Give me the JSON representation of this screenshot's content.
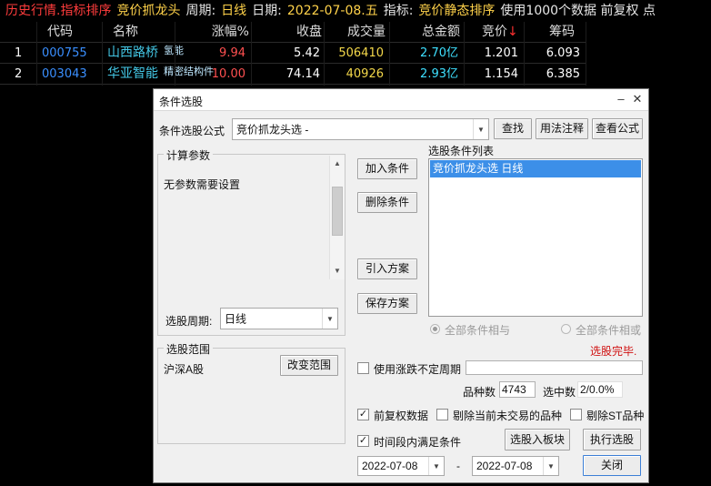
{
  "header": {
    "segments": [
      {
        "text": "历史行情.指标排序",
        "color": "red"
      },
      {
        "text": "竞价抓龙头",
        "color": "yellow"
      },
      {
        "text": "周期:",
        "color": "white"
      },
      {
        "text": "日线",
        "color": "yellow"
      },
      {
        "text": "日期:",
        "color": "white"
      },
      {
        "text": "2022-07-08.五",
        "color": "yellow"
      },
      {
        "text": "指标:",
        "color": "white"
      },
      {
        "text": "竞价静态排序",
        "color": "yellow"
      },
      {
        "text": "使用1000个数据 前复权 点",
        "color": "white"
      }
    ]
  },
  "table": {
    "columns": [
      "代码",
      "名称",
      "涨幅%",
      "收盘",
      "成交量",
      "总金额",
      "竞价",
      "筹码"
    ],
    "sort_arrow": "↓",
    "rows": [
      {
        "idx": "1",
        "code": "000755",
        "name": "山西路桥",
        "tag": "氢能",
        "chg": "9.94",
        "close": "5.42",
        "vol": "506410",
        "amount": "2.70亿",
        "bid": "1.201",
        "chip": "6.093"
      },
      {
        "idx": "2",
        "code": "003043",
        "name": "华亚智能",
        "tag": "精密结构件",
        "chg": "10.00",
        "close": "74.14",
        "vol": "40926",
        "amount": "2.93亿",
        "bid": "1.154",
        "chip": "6.385"
      }
    ]
  },
  "dialog": {
    "title": "条件选股",
    "formula_label": "条件选股公式",
    "formula_value": "竞价抓龙头选 -",
    "btn_find": "查找",
    "btn_usage": "用法注释",
    "btn_view": "查看公式",
    "params_group": "计算参数",
    "params_text": "无参数需要设置",
    "period_label": "选股周期:",
    "period_value": "日线",
    "btn_add": "加入条件",
    "btn_delete": "删除条件",
    "btn_import": "引入方案",
    "btn_save": "保存方案",
    "list_label": "选股条件列表",
    "list_items": [
      "竞价抓龙头选  日线"
    ],
    "radio_and": "全部条件相与",
    "radio_or": "全部条件相或",
    "status": "选股完毕.",
    "scope_group": "选股范围",
    "scope_value": "沪深A股",
    "btn_change_scope": "改变范围",
    "chk_uncertain": "使用涨跌不定周期",
    "count_label": "品种数",
    "count_value": "4743",
    "selected_label": "选中数",
    "selected_value": "2/0.0%",
    "chk_adjust": "前复权数据",
    "chk_exclude_untraded": "剔除当前未交易的品种",
    "chk_exclude_st": "剔除ST品种",
    "chk_period_match": "时间段内满足条件",
    "btn_to_block": "选股入板块",
    "btn_execute": "执行选股",
    "date_from": "2022-07-08",
    "date_dash": "-",
    "date_to": "2022-07-08",
    "btn_close": "关闭",
    "check_mark": "✓"
  }
}
